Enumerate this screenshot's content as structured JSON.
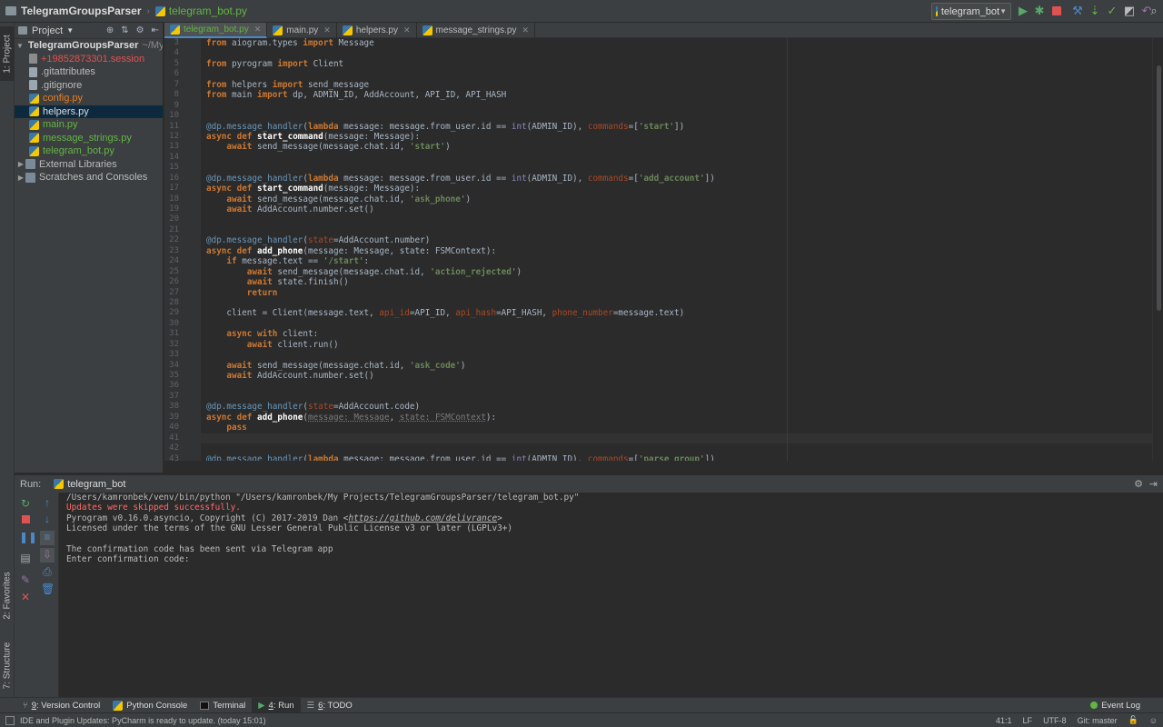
{
  "breadcrumb": {
    "project": "TelegramGroupsParser",
    "file": "telegram_bot.py"
  },
  "toolbar": {
    "run_config": "telegram_bot"
  },
  "left_strip": {
    "project": "1: Project",
    "favorites": "2: Favorites",
    "structure": "7: Structure"
  },
  "project_panel": {
    "header": "Project",
    "items": [
      {
        "label": "TelegramGroupsParser",
        "suffix": "~/My",
        "kind": "root"
      },
      {
        "label": "+19852873301.session",
        "kind": "session"
      },
      {
        "label": ".gitattributes",
        "kind": "text"
      },
      {
        "label": ".gitignore",
        "kind": "text"
      },
      {
        "label": "config.py",
        "kind": "modified"
      },
      {
        "label": "helpers.py",
        "kind": "selected"
      },
      {
        "label": "main.py",
        "kind": "added"
      },
      {
        "label": "message_strings.py",
        "kind": "added"
      },
      {
        "label": "telegram_bot.py",
        "kind": "added"
      },
      {
        "label": "External Libraries",
        "kind": "lib"
      },
      {
        "label": "Scratches and Consoles",
        "kind": "scratch"
      }
    ]
  },
  "tabs": [
    {
      "label": "telegram_bot.py",
      "active": true
    },
    {
      "label": "main.py",
      "active": false
    },
    {
      "label": "helpers.py",
      "active": false
    },
    {
      "label": "message_strings.py",
      "active": false
    }
  ],
  "code": [
    {
      "n": "3",
      "t": "from aiogram.types import Message"
    },
    {
      "n": "4",
      "t": ""
    },
    {
      "n": "5",
      "t": "from pyrogram import Client"
    },
    {
      "n": "6",
      "t": ""
    },
    {
      "n": "7",
      "t": "from helpers import send_message"
    },
    {
      "n": "8",
      "t": "from main import dp, ADMIN_ID, AddAccount, API_ID, API_HASH"
    },
    {
      "n": "9",
      "t": ""
    },
    {
      "n": "10",
      "t": ""
    },
    {
      "n": "11",
      "t": "@dp.message_handler(lambda message: message.from_user.id == int(ADMIN_ID), commands=['start'])"
    },
    {
      "n": "12",
      "t": "async def start_command(message: Message):"
    },
    {
      "n": "13",
      "t": "    await send_message(message.chat.id, 'start')"
    },
    {
      "n": "14",
      "t": ""
    },
    {
      "n": "15",
      "t": ""
    },
    {
      "n": "16",
      "t": "@dp.message_handler(lambda message: message.from_user.id == int(ADMIN_ID), commands=['add_account'])"
    },
    {
      "n": "17",
      "t": "async def start_command(message: Message):"
    },
    {
      "n": "18",
      "t": "    await send_message(message.chat.id, 'ask_phone')"
    },
    {
      "n": "19",
      "t": "    await AddAccount.number.set()"
    },
    {
      "n": "20",
      "t": ""
    },
    {
      "n": "21",
      "t": ""
    },
    {
      "n": "22",
      "t": "@dp.message_handler(state=AddAccount.number)"
    },
    {
      "n": "23",
      "t": "async def add_phone(message: Message, state: FSMContext):"
    },
    {
      "n": "24",
      "t": "    if message.text == '/start':"
    },
    {
      "n": "25",
      "t": "        await send_message(message.chat.id, 'action_rejected')"
    },
    {
      "n": "26",
      "t": "        await state.finish()"
    },
    {
      "n": "27",
      "t": "        return"
    },
    {
      "n": "28",
      "t": ""
    },
    {
      "n": "29",
      "t": "    client = Client(message.text, api_id=API_ID, api_hash=API_HASH, phone_number=message.text)"
    },
    {
      "n": "30",
      "t": ""
    },
    {
      "n": "31",
      "t": "    async with client:"
    },
    {
      "n": "32",
      "t": "        await client.run()"
    },
    {
      "n": "33",
      "t": ""
    },
    {
      "n": "34",
      "t": "    await send_message(message.chat.id, 'ask_code')"
    },
    {
      "n": "35",
      "t": "    await AddAccount.number.set()"
    },
    {
      "n": "36",
      "t": ""
    },
    {
      "n": "37",
      "t": ""
    },
    {
      "n": "38",
      "t": "@dp.message_handler(state=AddAccount.code)"
    },
    {
      "n": "39",
      "t": "async def add_phone(message: Message, state: FSMContext):"
    },
    {
      "n": "40",
      "t": "    pass"
    },
    {
      "n": "41",
      "t": ""
    },
    {
      "n": "42",
      "t": ""
    },
    {
      "n": "43",
      "t": "@dp.message_handler(lambda message: message.from_user.id == int(ADMIN_ID), commands=['parse_group'])"
    }
  ],
  "current_line": "41",
  "run_panel": {
    "label": "Run:",
    "tab": "telegram_bot",
    "console": [
      {
        "t": "/Users/kamronbek/venv/bin/python \"/Users/kamronbek/My Projects/TelegramGroupsParser/telegram_bot.py\"",
        "type": "normal"
      },
      {
        "t": "Updates were skipped successfully.",
        "type": "err"
      },
      {
        "t": "Pyrogram v0.16.0.asyncio, Copyright (C) 2017-2019 Dan <https://github.com/delivrance>",
        "type": "link"
      },
      {
        "t": "Licensed under the terms of the GNU Lesser General Public License v3 or later (LGPLv3+)",
        "type": "normal"
      },
      {
        "t": "",
        "type": "normal"
      },
      {
        "t": "The confirmation code has been sent via Telegram app",
        "type": "normal"
      },
      {
        "t": "Enter confirmation code:",
        "type": "normal"
      }
    ]
  },
  "bottom_tools": [
    {
      "key": "9",
      "label": ": Version Control",
      "icon": "vcs-icon"
    },
    {
      "key": "",
      "label": "Python Console",
      "icon": "python-console-icon"
    },
    {
      "key": "",
      "label": "Terminal",
      "icon": "terminal-icon"
    },
    {
      "key": "4",
      "label": ": Run",
      "icon": "run-icon",
      "active": true
    },
    {
      "key": "6",
      "label": ": TODO",
      "icon": "todo-icon"
    }
  ],
  "event_log": "Event Log",
  "status": {
    "message": "IDE and Plugin Updates: PyCharm is ready to update. (today 15:01)",
    "position": "41:1",
    "line_sep": "LF",
    "encoding": "UTF-8",
    "vcs": "Git: master"
  },
  "colors": {
    "accent_blue": "#4a88c7",
    "green": "#62b543",
    "red": "#e05252",
    "bg": "#2b2b2b",
    "panel": "#3c3f41"
  }
}
